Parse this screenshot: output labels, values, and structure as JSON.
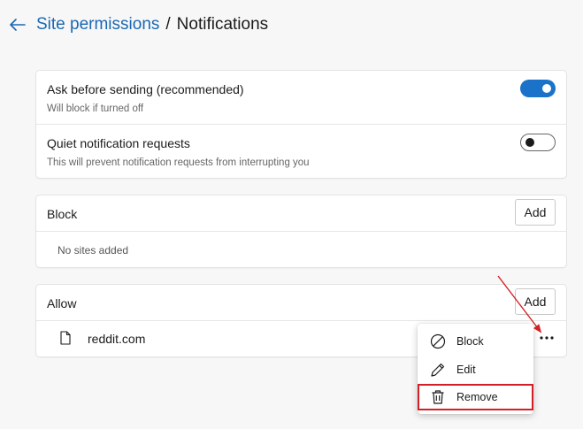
{
  "header": {
    "breadcrumb_parent": "Site permissions",
    "separator": "/",
    "page_title": "Notifications"
  },
  "settings": {
    "ask_before_sending": {
      "title": "Ask before sending (recommended)",
      "description": "Will block if turned off",
      "enabled": true
    },
    "quiet_requests": {
      "title": "Quiet notification requests",
      "description": "This will prevent notification requests from interrupting you",
      "enabled": false
    }
  },
  "block": {
    "title": "Block",
    "add_label": "Add",
    "empty_text": "No sites added"
  },
  "allow": {
    "title": "Allow",
    "add_label": "Add",
    "sites": [
      {
        "name": "reddit.com",
        "icon": "file-icon"
      }
    ]
  },
  "context_menu": {
    "items": [
      {
        "label": "Block",
        "icon": "block-icon"
      },
      {
        "label": "Edit",
        "icon": "pencil-icon"
      },
      {
        "label": "Remove",
        "icon": "trash-icon",
        "highlighted": true
      }
    ]
  },
  "colors": {
    "accent": "#1a73c8",
    "link": "#1a68b3",
    "annotation": "#d32027",
    "background": "#f7f7f7"
  }
}
